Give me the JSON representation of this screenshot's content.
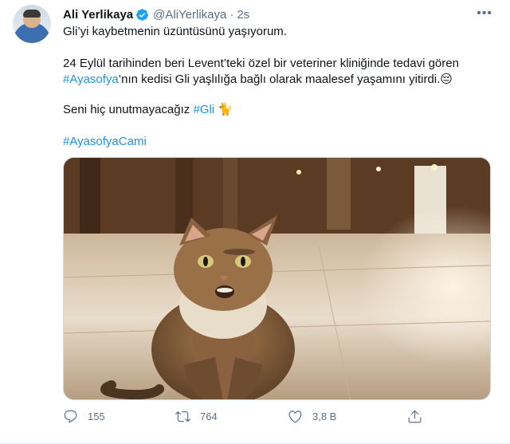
{
  "tweet": {
    "author_name": "Ali Yerlikaya",
    "handle": "@AliYerlikaya",
    "separator": "·",
    "time": "2s",
    "more": "•••",
    "line1": "Gli’yi kaybetmenin üzüntüsünü yaşıyorum.",
    "p2_a": "24 Eylül tarihinden beri Levent’teki özel bir veteriner kliniğinde tedavi gören ",
    "p2_tag": "#Ayasofya",
    "p2_b": "’nın kedisi Gli yaşlılığa bağlı olarak maalesef yaşamını yitirdi.",
    "p2_emoji": "😔",
    "p3_a": "Seni hiç unutmayacağız ",
    "p3_tag": "#Gli",
    "p3_emoji": "🐈",
    "p4_tag": "#AyasofyaCami",
    "media_alt": "cat photo"
  },
  "actions": {
    "reply_count": "155",
    "retweet_count": "764",
    "like_count": "3,8 B"
  },
  "icons": {
    "verified": "verified-badge-icon",
    "reply": "reply-icon",
    "retweet": "retweet-icon",
    "like": "heart-icon",
    "share": "share-icon"
  },
  "colors": {
    "accent": "#1b95e0",
    "muted": "#5b7083",
    "text": "#0f1419"
  }
}
